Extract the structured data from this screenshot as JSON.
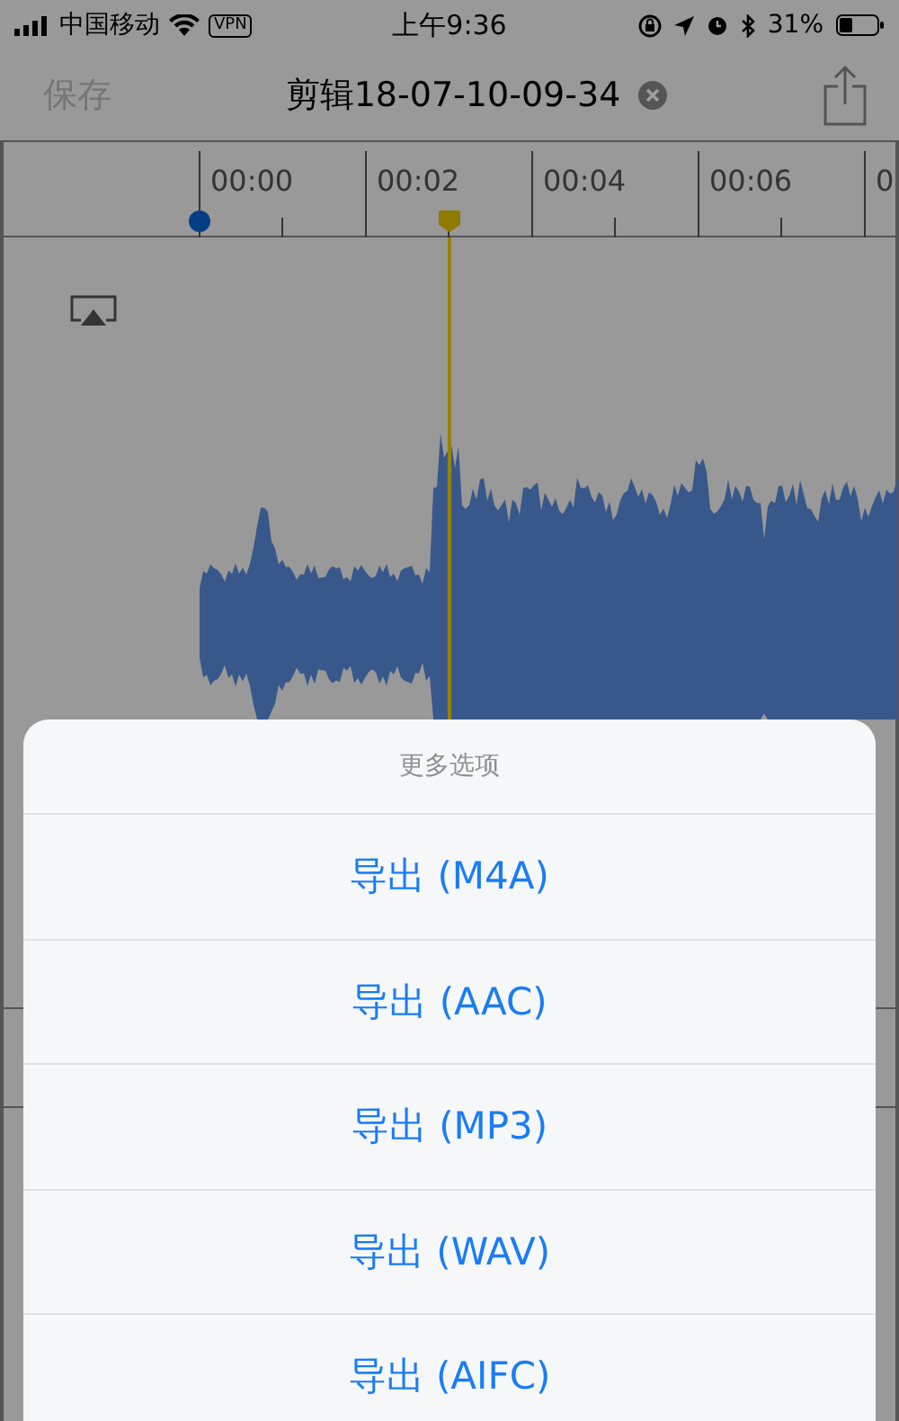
{
  "status_bar": {
    "carrier": "中国移动",
    "vpn": "VPN",
    "time": "上午9:36",
    "battery": "31%"
  },
  "nav_bar": {
    "save": "保存",
    "title": "剪辑18-07-10-09-34"
  },
  "ruler": {
    "labels": [
      "00:00",
      "00:02",
      "00:04",
      "00:06",
      "0"
    ]
  },
  "action_sheet": {
    "title": "更多选项",
    "items": [
      {
        "label": "导出 (M4A)"
      },
      {
        "label": "导出 (AAC)"
      },
      {
        "label": "导出 (MP3)"
      },
      {
        "label": "导出 (WAV)"
      },
      {
        "label": "导出 (AIFC)"
      }
    ]
  }
}
